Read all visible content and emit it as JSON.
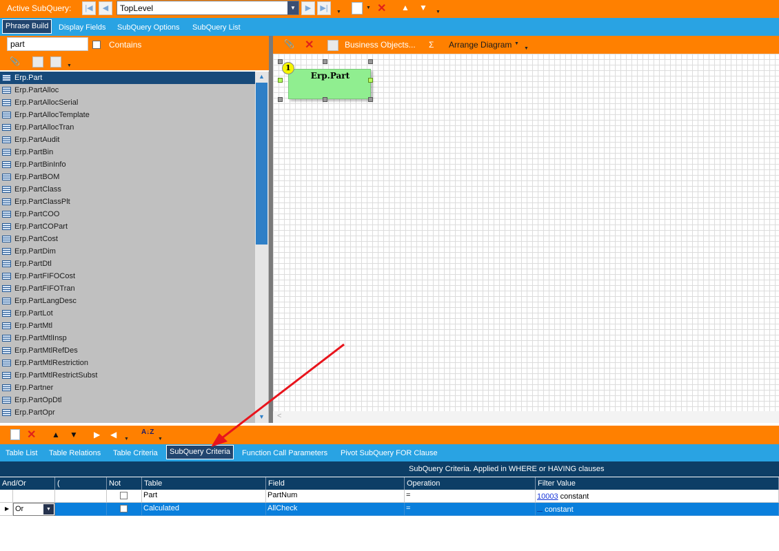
{
  "topbar": {
    "active_label": "Active SubQuery:",
    "subquery_value": "TopLevel"
  },
  "main_tabs": [
    "Phrase Build",
    "Display Fields",
    "SubQuery Options",
    "SubQuery List"
  ],
  "search": {
    "value": "part",
    "contains_label": "Contains"
  },
  "tables": [
    "Erp.Part",
    "Erp.PartAlloc",
    "Erp.PartAllocSerial",
    "Erp.PartAllocTemplate",
    "Erp.PartAllocTran",
    "Erp.PartAudit",
    "Erp.PartBin",
    "Erp.PartBinInfo",
    "Erp.PartBOM",
    "Erp.PartClass",
    "Erp.PartClassPlt",
    "Erp.PartCOO",
    "Erp.PartCOPart",
    "Erp.PartCost",
    "Erp.PartDim",
    "Erp.PartDtl",
    "Erp.PartFIFOCost",
    "Erp.PartFIFOTran",
    "Erp.PartLangDesc",
    "Erp.PartLot",
    "Erp.PartMtl",
    "Erp.PartMtlInsp",
    "Erp.PartMtlRefDes",
    "Erp.PartMtlRestriction",
    "Erp.PartMtlRestrictSubst",
    "Erp.Partner",
    "Erp.PartOpDtl",
    "Erp.PartOpr"
  ],
  "diagram": {
    "business_objects": "Business Objects...",
    "sigma": "Σ",
    "arrange": "Arrange Diagram",
    "table_name": "Erp.Part",
    "badge": "1"
  },
  "bottom_tabs": [
    "Table List",
    "Table Relations",
    "Table Criteria",
    "SubQuery Criteria",
    "Function Call Parameters",
    "Pivot SubQuery FOR Clause"
  ],
  "criteria": {
    "title": "SubQuery Criteria. Applied in WHERE or HAVING clauses",
    "columns": [
      "And/Or",
      "(",
      "Not",
      "Table",
      "Field",
      "Operation",
      "Filter Value"
    ],
    "rows": [
      {
        "andor": "",
        "paren": "",
        "table": "Part",
        "field": "PartNum",
        "op": "=",
        "value_link": "10003",
        "value_type": "constant"
      },
      {
        "andor": "Or",
        "paren": "",
        "table": "Calculated",
        "field": "AllCheck",
        "op": "=",
        "value_link": "",
        "value_type": "constant"
      }
    ]
  },
  "colors": {
    "orange": "#ff8000",
    "blue": "#29a3e3",
    "navy": "#0d3e66",
    "selected_row": "#0a7fdc",
    "arrow": "#e8141c"
  }
}
